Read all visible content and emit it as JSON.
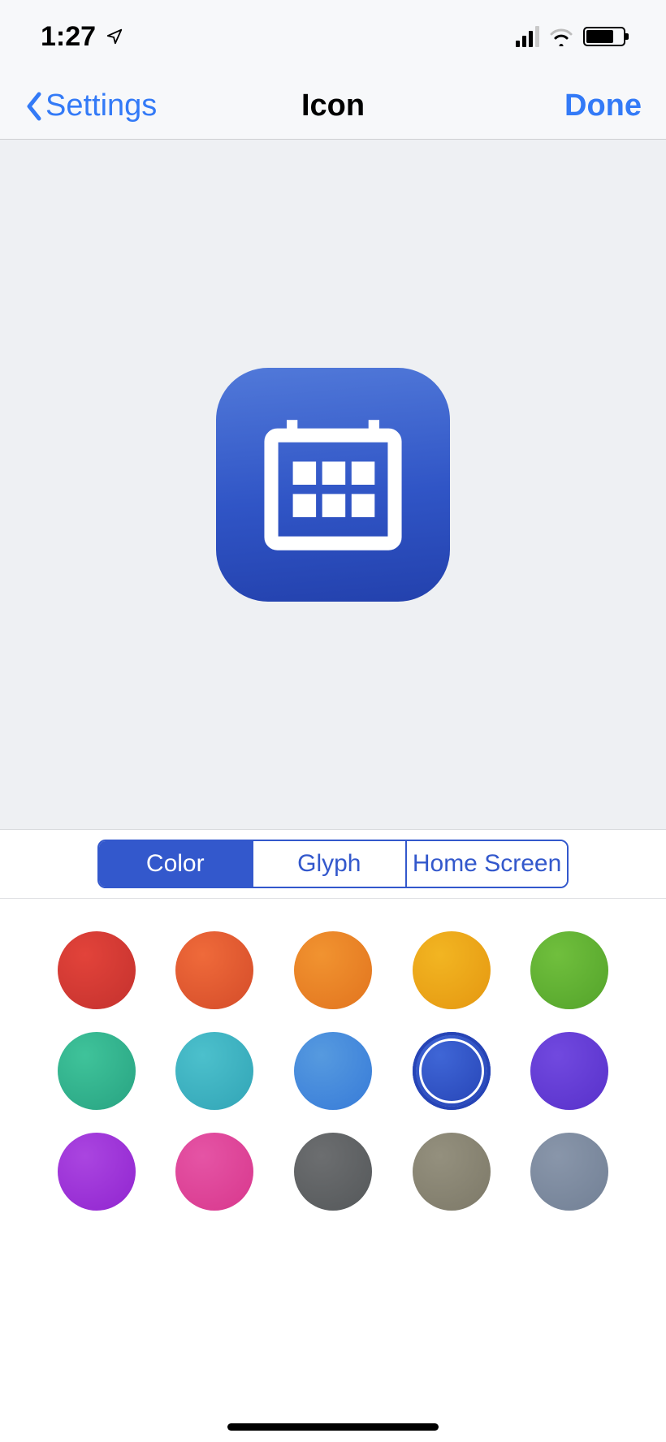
{
  "status_bar": {
    "time": "1:27"
  },
  "nav": {
    "back_label": "Settings",
    "title": "Icon",
    "done_label": "Done"
  },
  "preview": {
    "glyph": "calendar",
    "background_gradient": [
      "#5179d9",
      "#2341ad"
    ]
  },
  "segmented": {
    "selected_index": 0,
    "items": [
      {
        "label": "Color"
      },
      {
        "label": "Glyph"
      },
      {
        "label": "Home Screen"
      }
    ]
  },
  "colors": {
    "selected_index": 8,
    "swatches": [
      {
        "name": "red",
        "gradient": [
          "#e2433a",
          "#c7332f"
        ]
      },
      {
        "name": "red-orange",
        "gradient": [
          "#ef6a3a",
          "#d74f2b"
        ]
      },
      {
        "name": "orange",
        "gradient": [
          "#f19330",
          "#e37720"
        ]
      },
      {
        "name": "yellow",
        "gradient": [
          "#f2b522",
          "#e69a12"
        ]
      },
      {
        "name": "green",
        "gradient": [
          "#70bf3d",
          "#56a62c"
        ]
      },
      {
        "name": "teal",
        "gradient": [
          "#3fc39a",
          "#2aa684"
        ]
      },
      {
        "name": "cyan",
        "gradient": [
          "#4cc0cc",
          "#34a7b8"
        ]
      },
      {
        "name": "light-blue",
        "gradient": [
          "#569adf",
          "#3a7ed9"
        ]
      },
      {
        "name": "blue",
        "gradient": [
          "#3f66d6",
          "#2644b6"
        ]
      },
      {
        "name": "indigo",
        "gradient": [
          "#7149df",
          "#5a33cc"
        ]
      },
      {
        "name": "purple",
        "gradient": [
          "#aa45e0",
          "#9328d1"
        ]
      },
      {
        "name": "pink",
        "gradient": [
          "#e554a5",
          "#d93a8f"
        ]
      },
      {
        "name": "dark-gray",
        "gradient": [
          "#6c6e70",
          "#575a5c"
        ]
      },
      {
        "name": "khaki",
        "gradient": [
          "#94907e",
          "#7f7b6a"
        ]
      },
      {
        "name": "blue-gray",
        "gradient": [
          "#8996aa",
          "#748297"
        ]
      }
    ]
  }
}
